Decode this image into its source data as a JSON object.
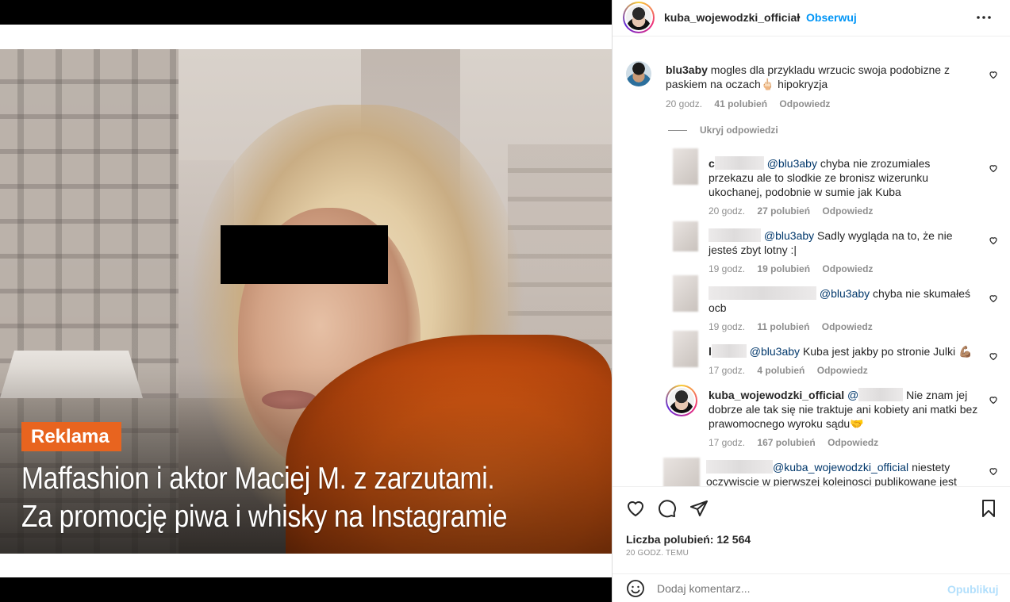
{
  "media": {
    "ad_badge": "Reklama",
    "headline_line1": "Maffashion i aktor Maciej M. z zarzutami.",
    "headline_line2": "Za promocję piwa i whisky na Instagramie"
  },
  "header": {
    "username": "kuba_wojewodzki_official",
    "dot": "•",
    "follow_label": "Obserwuj",
    "more_icon": "more-horizontal-icon"
  },
  "comments": {
    "main": {
      "username": "blu3aby",
      "text": "mogles dla przykladu wrzucic swoja podobizne z paskiem na oczach🖕🏻 hipokryzja",
      "time": "20 godz.",
      "likes": "41 polubień",
      "reply": "Odpowiedz"
    },
    "hide_replies": "Ukryj odpowiedzi",
    "replies": [
      {
        "username_initial": "c",
        "mention": "@blu3aby",
        "text": "chyba nie zrozumiales przekazu ale to slodkie ze bronisz wizerunku ukochanej, podobnie w sumie jak Kuba",
        "time": "20 godz.",
        "likes": "27 polubień",
        "reply": "Odpowiedz"
      },
      {
        "mention": "@blu3aby",
        "text": "Sadly wygląda na to, że nie jesteś zbyt lotny :|",
        "time": "19 godz.",
        "likes": "19 polubień",
        "reply": "Odpowiedz"
      },
      {
        "mention": "@blu3aby",
        "text": "chyba nie skumałeś ocb",
        "time": "19 godz.",
        "likes": "11 polubień",
        "reply": "Odpowiedz"
      },
      {
        "username_initial": "l",
        "mention": "@blu3aby",
        "text": "Kuba jest jakby po stronie Julki 💪🏽",
        "time": "17 godz.",
        "likes": "4 polubień",
        "reply": "Odpowiedz"
      },
      {
        "username": "kuba_wojewodzki_official",
        "mention": "@",
        "text": "Nie znam jej dobrze ale tak się nie traktuje ani kobiety ani matki bez prawomocnego wyroku sądu🤝",
        "time": "17 godz.",
        "likes": "167 polubień",
        "reply": "Odpowiedz"
      },
      {
        "mention": "@kuba_wojewodzki_official",
        "text": "niestety oczywiscie w pierwszej kolejnosci publikowane jest"
      }
    ]
  },
  "actions": {
    "like_icon": "heart-icon",
    "comment_icon": "comment-icon",
    "share_icon": "send-icon",
    "save_icon": "bookmark-icon",
    "likes_label": "Liczba polubień: 12 564",
    "time_ago": "20 GODZ. TEMU"
  },
  "add_comment": {
    "emoji_icon": "emoji-icon",
    "placeholder": "Dodaj komentarz...",
    "post_label": "Opublikuj"
  },
  "colors": {
    "accent": "#0095f6",
    "badge": "#e8641f",
    "jacket": "#cf5511"
  }
}
